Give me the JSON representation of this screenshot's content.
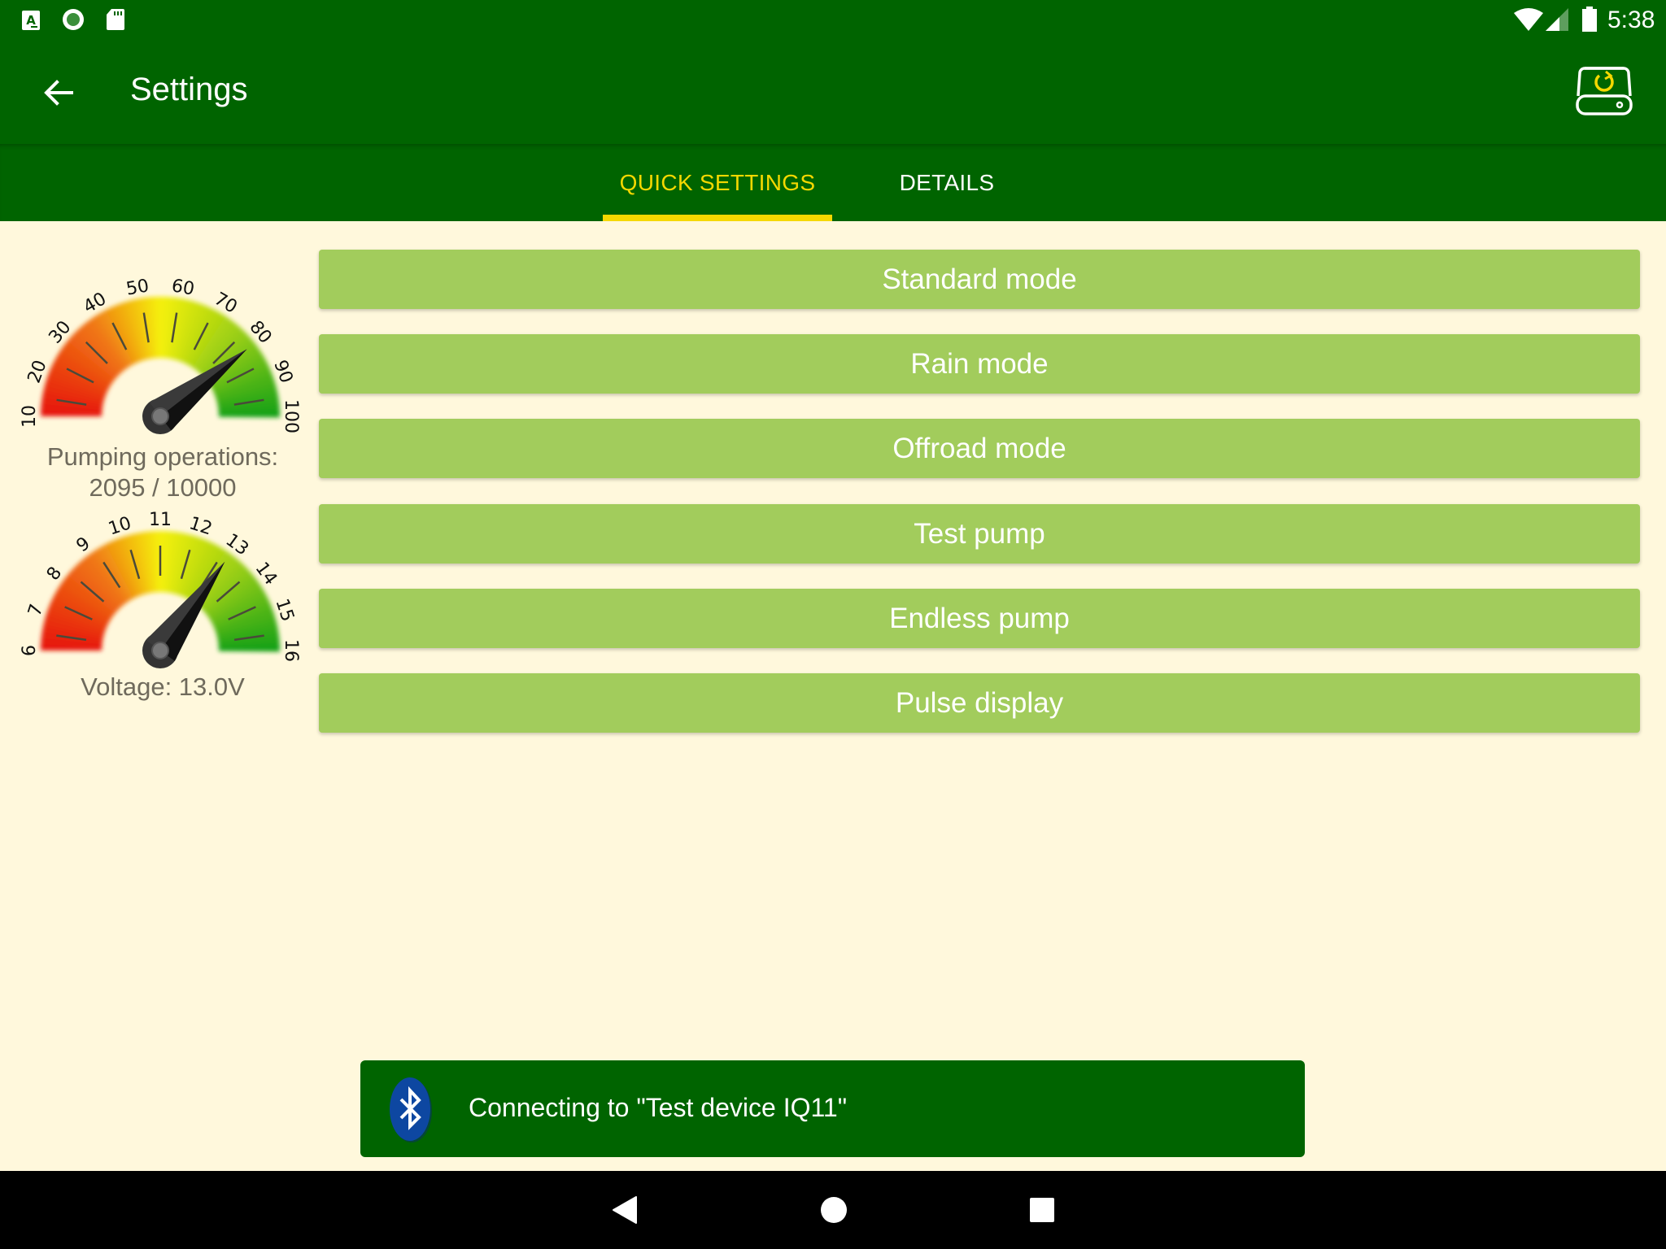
{
  "status_bar": {
    "left_icons": [
      "accessibility-icon",
      "record-icon",
      "sd-card-icon"
    ],
    "right_icons": [
      "wifi-icon",
      "cell-signal-icon",
      "battery-icon"
    ],
    "time": "5:38"
  },
  "toolbar": {
    "back_icon": "arrow-left-icon",
    "title": "Settings",
    "action_icon": "device-sync-icon"
  },
  "tabs": [
    {
      "label": "QUICK SETTINGS",
      "selected": true
    },
    {
      "label": "DETAILS",
      "selected": false
    }
  ],
  "gauges": [
    {
      "name": "pumping-operations",
      "ticks": [
        "10",
        "20",
        "30",
        "40",
        "50",
        "60",
        "70",
        "80",
        "90",
        "100"
      ],
      "min": 0,
      "max": 100,
      "needle_value": 79,
      "label_line1": "Pumping operations:",
      "label_line2": "2095 / 10000"
    },
    {
      "name": "voltage",
      "ticks": [
        "6",
        "7",
        "8",
        "9",
        "10",
        "11",
        "12",
        "13",
        "14",
        "15",
        "16"
      ],
      "min": 6,
      "max": 16,
      "needle_value": 13.0,
      "label_line1": "Voltage: 13.0V"
    }
  ],
  "mode_buttons": [
    {
      "label": "Standard mode"
    },
    {
      "label": "Rain mode"
    },
    {
      "label": "Offroad mode"
    },
    {
      "label": "Test pump"
    },
    {
      "label": "Endless pump"
    },
    {
      "label": "Pulse display"
    }
  ],
  "snackbar": {
    "icon": "bluetooth-icon",
    "message": "Connecting to \"Test device IQ11\""
  },
  "nav_bar": {
    "buttons": [
      "back-icon",
      "home-icon",
      "recents-icon"
    ]
  },
  "colors": {
    "primary": "#006400",
    "accent": "#f5d800",
    "button": "#a2cc5c",
    "background": "#fff8dc"
  }
}
